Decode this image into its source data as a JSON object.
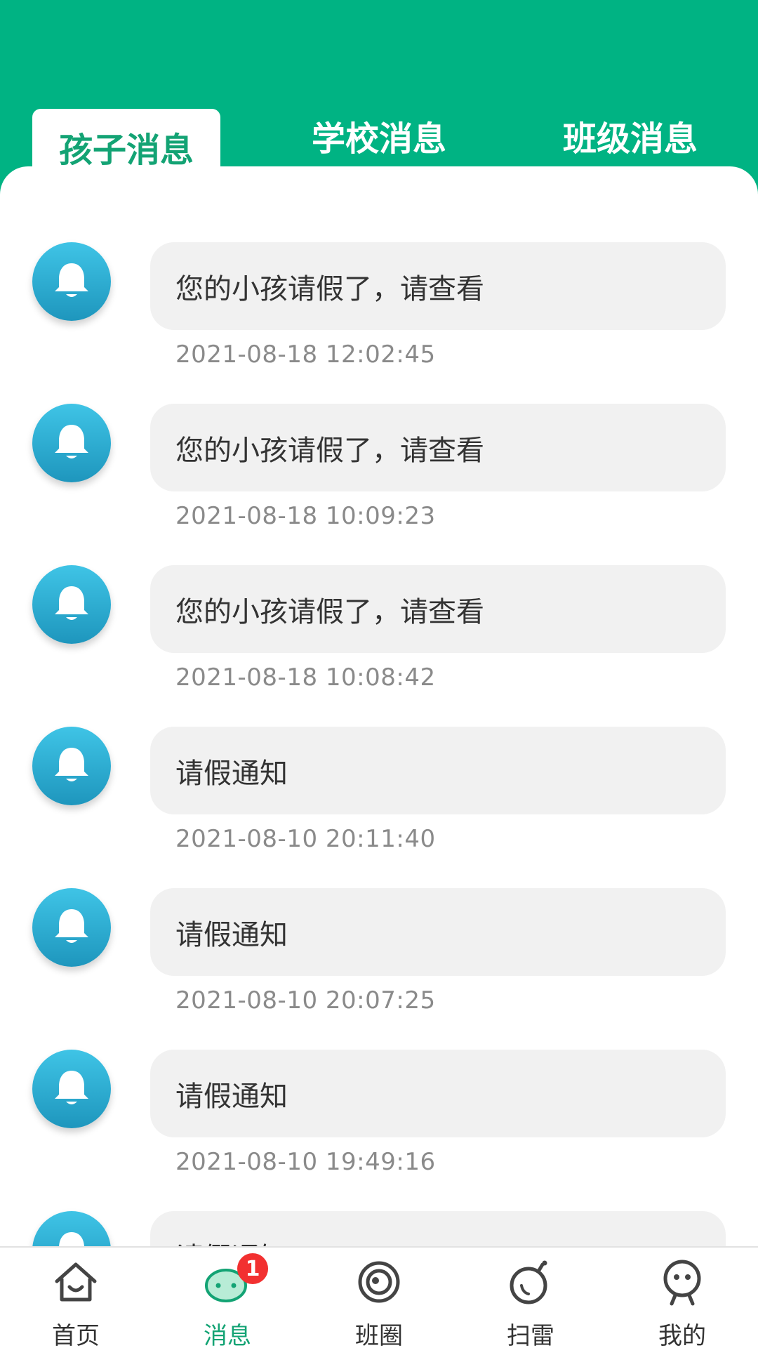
{
  "header": {
    "tabs": [
      {
        "label": "孩子消息",
        "active": true
      },
      {
        "label": "学校消息",
        "active": false
      },
      {
        "label": "班级消息",
        "active": false
      }
    ],
    "background_color": "#00b383",
    "active_tab_color": "#13a374"
  },
  "messages": [
    {
      "text": "您的小孩请假了，请查看",
      "time": "2021-08-18 12:02:45",
      "icon": "bell-icon"
    },
    {
      "text": "您的小孩请假了，请查看",
      "time": "2021-08-18 10:09:23",
      "icon": "bell-icon"
    },
    {
      "text": "您的小孩请假了，请查看",
      "time": "2021-08-18 10:08:42",
      "icon": "bell-icon"
    },
    {
      "text": "请假通知",
      "time": "2021-08-10 20:11:40",
      "icon": "bell-icon"
    },
    {
      "text": "请假通知",
      "time": "2021-08-10 20:07:25",
      "icon": "bell-icon"
    },
    {
      "text": "请假通知",
      "time": "2021-08-10 19:49:16",
      "icon": "bell-icon"
    },
    {
      "text": "请假通知",
      "time": "",
      "icon": "bell-icon"
    }
  ],
  "bottom_nav": {
    "items": [
      {
        "label": "首页",
        "icon": "home-icon",
        "active": false
      },
      {
        "label": "消息",
        "icon": "message-icon",
        "active": true,
        "badge": "1"
      },
      {
        "label": "班圈",
        "icon": "circle-icon",
        "active": false
      },
      {
        "label": "扫雷",
        "icon": "bomb-icon",
        "active": false
      },
      {
        "label": "我的",
        "icon": "profile-icon",
        "active": false
      }
    ]
  }
}
